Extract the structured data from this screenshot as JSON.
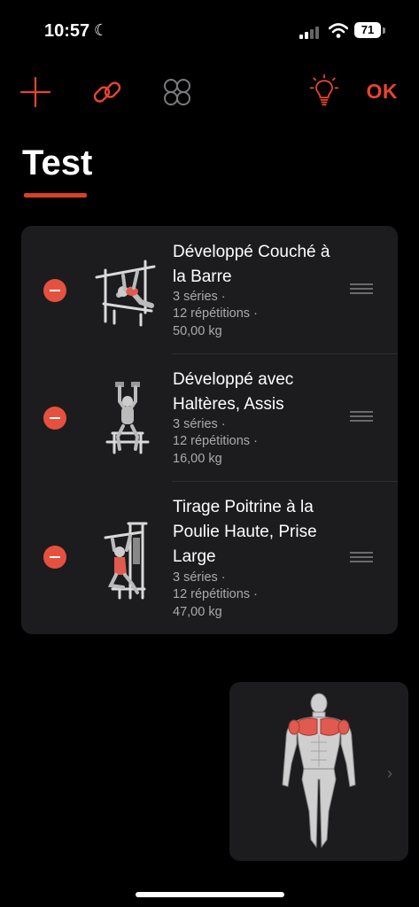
{
  "status_bar": {
    "time": "10:57",
    "battery": "71"
  },
  "toolbar": {
    "ok_label": "OK"
  },
  "workout": {
    "title": "Test"
  },
  "exercises": [
    {
      "name": "Développé Couché à la Barre",
      "sets": "3 séries ·",
      "reps": "12 répétitions ·",
      "weight": "50,00 kg"
    },
    {
      "name": "Développé avec Haltères, Assis",
      "sets": "3 séries ·",
      "reps": "12 répétitions ·",
      "weight": "16,00 kg"
    },
    {
      "name": "Tirage Poitrine à la Poulie Haute, Prise Large",
      "sets": "3 séries ·",
      "reps": "12 répétitions ·",
      "weight": "47,00 kg"
    }
  ],
  "colors": {
    "accent": "#e8452f",
    "card": "#1c1c1e",
    "muscle_highlight": "#e05a50"
  },
  "icons": [
    "moon-icon",
    "signal-icon",
    "wifi-icon",
    "battery-icon",
    "plus-icon",
    "link-icon",
    "circuit-icon",
    "lightbulb-icon",
    "minus-circle-icon",
    "drag-handle-icon",
    "chevron-right-icon"
  ]
}
